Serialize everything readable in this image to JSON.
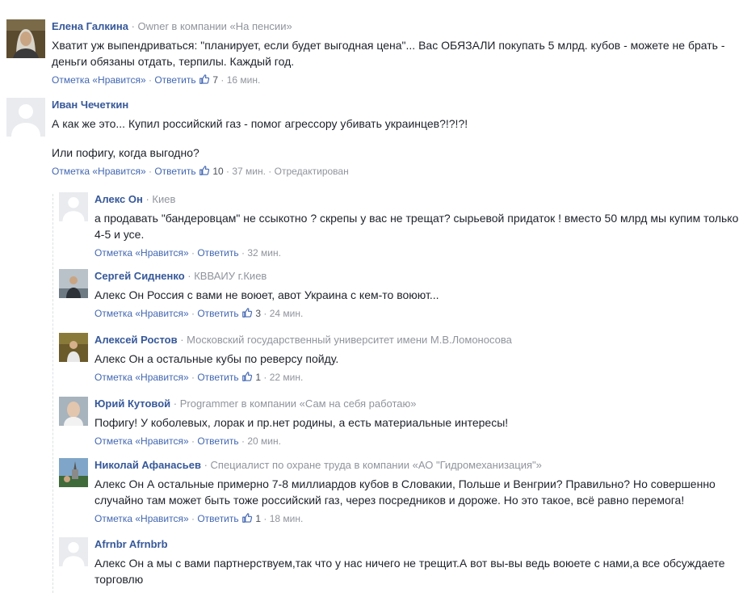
{
  "comments": [
    {
      "author": "Елена Галкина",
      "subtitle": "· Owner в компании «На пенсии»",
      "text": [
        "Хватит уж выпендриваться: \"планирует, если будет выгодная цена\"... Вас ОБЯЗАЛИ покупать 5 млрд. кубов - можете не брать -",
        "деньги обязаны отдать, терпилы. Каждый год."
      ],
      "like_label": "Отметка «Нравится»",
      "reply_label": "Ответить",
      "likes": "7",
      "time": "16 мин."
    },
    {
      "author": "Иван Чечеткин",
      "subtitle": "",
      "text": [
        "А как же это... Купил российский газ - помог агрессору убивать украинцев?!?!?!",
        "",
        "Или пофигу, когда выгодно?"
      ],
      "like_label": "Отметка «Нравится»",
      "reply_label": "Ответить",
      "likes": "10",
      "time": "37 мин.",
      "edited": "Отредактирован"
    }
  ],
  "replies": [
    {
      "author": "Алекс Он",
      "subtitle": "· Киев",
      "text": [
        "а продавать \"бандеровцам\" не ссыкотно ? скрепы у вас не трещат? сырьевой придаток ! вместо 50 млрд мы купим только",
        "4-5 и усе."
      ],
      "like_label": "Отметка «Нравится»",
      "reply_label": "Ответить",
      "likes": "",
      "time": "32 мин."
    },
    {
      "author": "Сергей Сидненко",
      "subtitle": "· КВВАИУ г.Киев",
      "text": [
        "Алекс Он Россия с вами не воюет, авот Украина с кем-то воюют..."
      ],
      "like_label": "Отметка «Нравится»",
      "reply_label": "Ответить",
      "likes": "3",
      "time": "24 мин."
    },
    {
      "author": "Алексей Ростов",
      "subtitle": "· Московский государственный университет имени М.В.Ломоносова",
      "text": [
        "Алекс Он а остальные кубы по реверсу пойду."
      ],
      "like_label": "Отметка «Нравится»",
      "reply_label": "Ответить",
      "likes": "1",
      "time": "22 мин."
    },
    {
      "author": "Юрий Кутовой",
      "subtitle": "· Programmer в компании «Сам на себя работаю»",
      "text": [
        "Пофигу! У коболевых, лорак и пр.нет родины, а есть материальные интересы!"
      ],
      "like_label": "Отметка «Нравится»",
      "reply_label": "Ответить",
      "likes": "",
      "time": "20 мин."
    },
    {
      "author": "Николай Афанасьев",
      "subtitle": "· Специалист по охране труда в компании «АО \"Гидромеханизация\"»",
      "text": [
        "Алекс Он А остальные примерно 7-8 миллиардов кубов в Словакии, Польше и Венгрии? Правильно? Но совершенно",
        "случайно там может быть тоже российский газ, через посредников и дороже. Но это такое, всё равно перемога!"
      ],
      "like_label": "Отметка «Нравится»",
      "reply_label": "Ответить",
      "likes": "1",
      "time": "18 мин."
    },
    {
      "author": "Afrnbr Afrnbrb",
      "subtitle": "",
      "text": [
        "Алекс Он а мы с вами партнерствуем,так что у нас ничего не трещит.А вот вы-вы ведь воюете с нами,а все обсуждаете",
        "торговлю"
      ]
    }
  ],
  "colors": {
    "name": "#365899",
    "link": "#4267b2",
    "meta": "#90949c",
    "text": "#1d2129"
  },
  "icons": {
    "like": "thumbs-up-icon",
    "avatar_placeholder": "silhouette-icon"
  }
}
